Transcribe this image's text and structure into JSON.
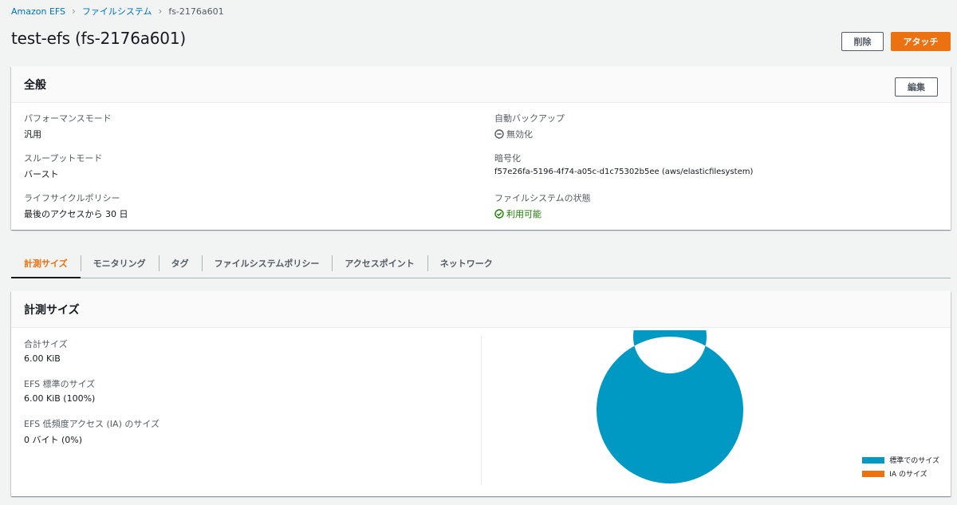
{
  "breadcrumb": {
    "items": [
      "Amazon EFS",
      "ファイルシステム",
      "fs-2176a601"
    ]
  },
  "page": {
    "title": "test-efs (fs-2176a601)",
    "delete_label": "削除",
    "attach_label": "アタッチ"
  },
  "general": {
    "title": "全般",
    "edit_label": "編集",
    "performance_mode_label": "パフォーマンスモード",
    "performance_mode_value": "汎用",
    "throughput_mode_label": "スループットモード",
    "throughput_mode_value": "バースト",
    "lifecycle_policy_label": "ライフサイクルポリシー",
    "lifecycle_policy_value": "最後のアクセスから 30 日",
    "auto_backup_label": "自動バックアップ",
    "auto_backup_value": "無効化",
    "encryption_label": "暗号化",
    "encryption_value": "f57e26fa-5196-4f74-a05c-d1c75302b5ee (aws/elasticfilesystem)",
    "state_label": "ファイルシステムの状態",
    "state_value": "利用可能"
  },
  "tabs": [
    "計測サイズ",
    "モニタリング",
    "タグ",
    "ファイルシステムポリシー",
    "アクセスポイント",
    "ネットワーク"
  ],
  "metered": {
    "title": "計測サイズ",
    "total_label": "合計サイズ",
    "total_value": "6.00 KiB",
    "standard_label": "EFS 標準のサイズ",
    "standard_value": "6.00 KiB (100%)",
    "ia_label": "EFS 低頻度アクセス (IA) のサイズ",
    "ia_value": "0 バイト (0%)"
  },
  "chart_data": {
    "type": "pie",
    "donut": true,
    "categories": [
      "標準でのサイズ",
      "IA のサイズ"
    ],
    "values": [
      100,
      0
    ],
    "colors": [
      "#0099c4",
      "#ec7211"
    ],
    "legend": "bottom-right"
  },
  "colors": {
    "accent": "#ec7211",
    "link": "#0073bb",
    "success": "#1d8102"
  }
}
